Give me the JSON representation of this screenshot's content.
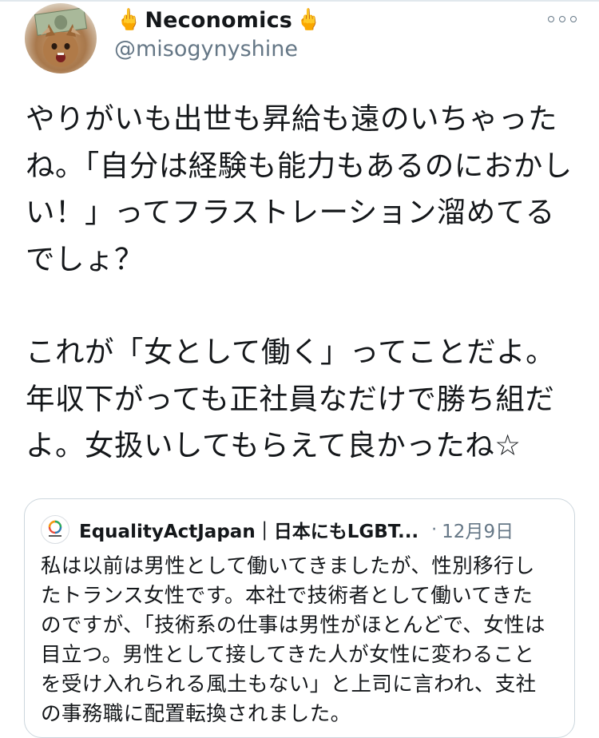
{
  "tweet": {
    "author": {
      "display_name": "Neconomics",
      "handle": "@misogynyshine",
      "name_prefix_emoji": "🖕",
      "name_suffix_emoji": "🖕",
      "avatar_icon": "cat-with-dollar-bill-avatar"
    },
    "more_icon": "more-options-icon",
    "paragraphs": [
      "やりがいも出世も昇給も遠のいちゃったね。「自分は経験も能力もあるのにおかしい！」ってフラストレーション溜めてるでしょ？",
      "これが「女として働く」ってことだよ。年収下がっても正社員なだけで勝ち組だよ。女扱いしてもらえて良かったね☆"
    ],
    "quoted": {
      "display_name": "EqualityActJapan｜日本にもLGBT...",
      "separator": "·",
      "date": "12月9日",
      "avatar_icon": "equality-act-japan-logo",
      "text": "私は以前は男性として働いてきましたが、性別移行したトランス女性です。本社で技術者として働いてきたのですが、「技術系の仕事は男性がほとんどで、女性は目立つ。男性として接してきた人が女性に変わることを受け入れられる風土もない」と上司に言われ、支社の事務職に配置転換されました。"
    }
  },
  "colors": {
    "text_primary": "#14171a",
    "text_secondary": "#657786",
    "border": "#ccd6dd",
    "emoji_yellow": "#f2b63a"
  }
}
